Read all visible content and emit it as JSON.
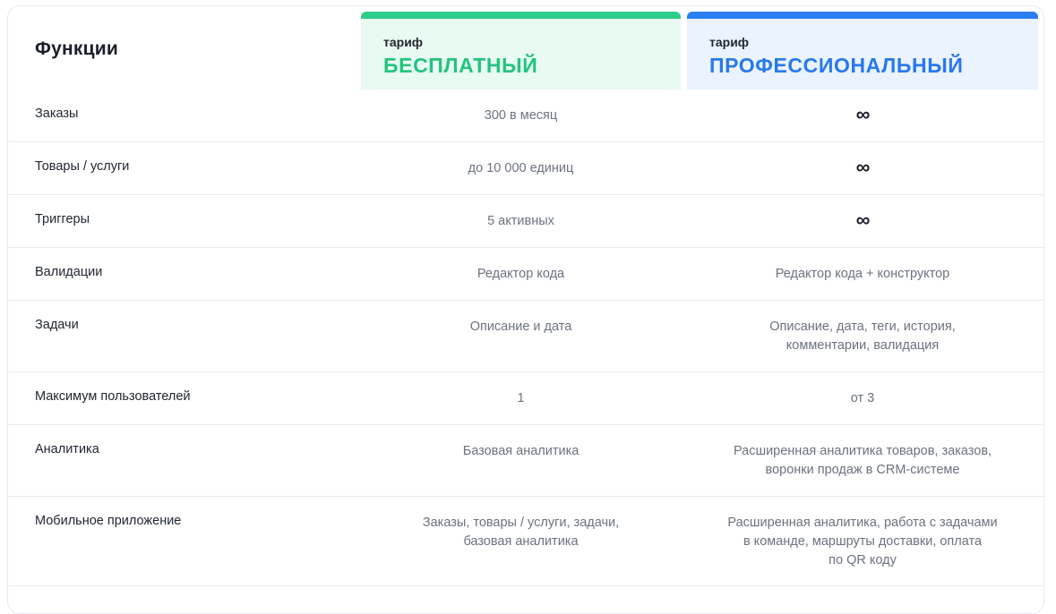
{
  "header": {
    "functions_title": "Функции",
    "plans": [
      {
        "label": "тариф",
        "name": "БЕСПЛАТНЫЙ",
        "accent": "#2fcc8b"
      },
      {
        "label": "тариф",
        "name": "ПРОФЕССИОНАЛЬНЫЙ",
        "accent": "#2c7ef3"
      }
    ]
  },
  "rows": [
    {
      "feature": "Заказы",
      "free": "300 в месяц",
      "pro": "∞",
      "pro_is_icon": true
    },
    {
      "feature": "Товары / услуги",
      "free": "до 10 000 единиц",
      "pro": "∞",
      "pro_is_icon": true
    },
    {
      "feature": "Триггеры",
      "free": "5 активных",
      "pro": "∞",
      "pro_is_icon": true
    },
    {
      "feature": "Валидации",
      "free": "Редактор кода",
      "pro": "Редактор кода + конструктор"
    },
    {
      "feature": "Задачи",
      "free": "Описание и дата",
      "pro": "Описание, дата, теги, история,\nкомментарии, валидация"
    },
    {
      "feature": "Максимум пользователей",
      "free": "1",
      "pro": "от 3"
    },
    {
      "feature": "Аналитика",
      "free": "Базовая аналитика",
      "pro": "Расширенная аналитика товаров, заказов,\nворонки продаж в CRM-системе"
    },
    {
      "feature": "Мобильное приложение",
      "free": "Заказы, товары / услуги, задачи,\nбазовая аналитика",
      "pro": "Расширенная аналитика, работа с задачами\nв команде, маршруты доставки, оплата\nпо QR коду"
    }
  ]
}
